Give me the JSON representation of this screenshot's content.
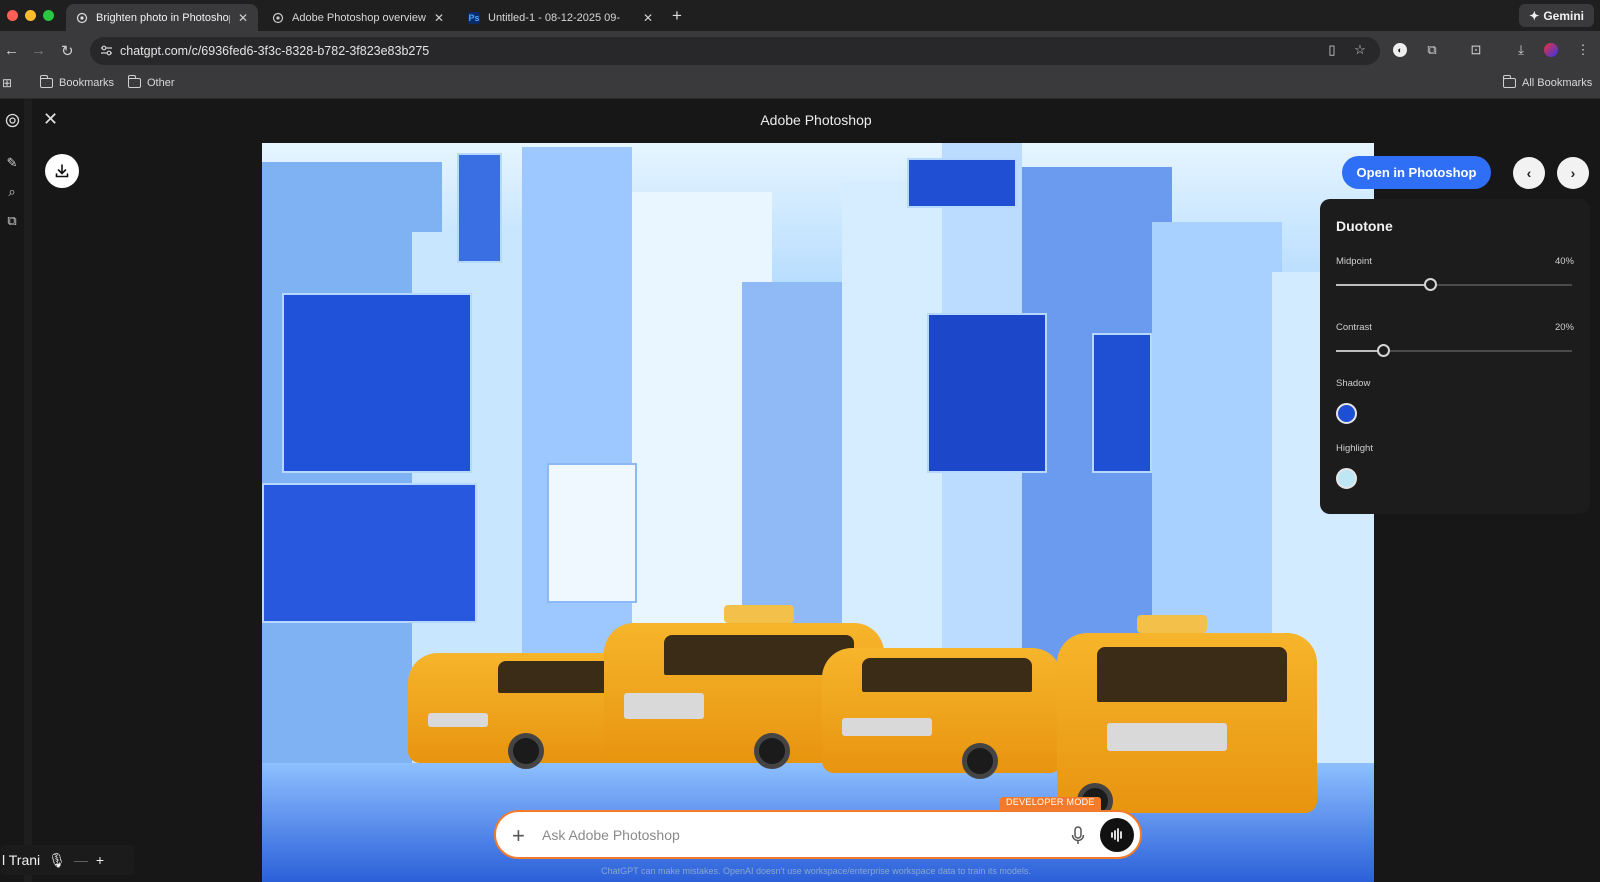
{
  "browser": {
    "tabs": [
      {
        "label": "Brighten photo in Photoshop",
        "active": true
      },
      {
        "label": "Adobe Photoshop overview",
        "active": false
      },
      {
        "label": "Untitled-1 - 08-12-2025 09-",
        "active": false
      }
    ],
    "gemini_label": "Gemini",
    "url": "chatgpt.com/c/6936fed6-3f3c-8328-b782-3f823e83b275",
    "bookmarks": [
      "Bookmarks",
      "Other"
    ],
    "all_bookmarks": "All Bookmarks"
  },
  "modal": {
    "title": "Adobe Photoshop",
    "open_in_photoshop": "Open in Photoshop"
  },
  "duotone": {
    "title": "Duotone",
    "midpoint": {
      "label": "Midpoint",
      "value_text": "40%",
      "value": 0.4
    },
    "contrast": {
      "label": "Contrast",
      "value_text": "20%",
      "value": 0.2
    },
    "shadow": {
      "label": "Shadow",
      "color": "#1d4fd6"
    },
    "highlight": {
      "label": "Highlight",
      "color": "#bfe6f5"
    }
  },
  "composer": {
    "placeholder": "Ask Adobe Photoshop",
    "developer_mode": "DEVELOPER MODE",
    "disclaimer": "ChatGPT can make mistakes. OpenAI doesn't use workspace/enterprise workspace data to train its models."
  },
  "overlay": {
    "text": "l Trani"
  },
  "colors": {
    "accent": "#2f6ff5",
    "composer_border": "#f37a2a"
  }
}
